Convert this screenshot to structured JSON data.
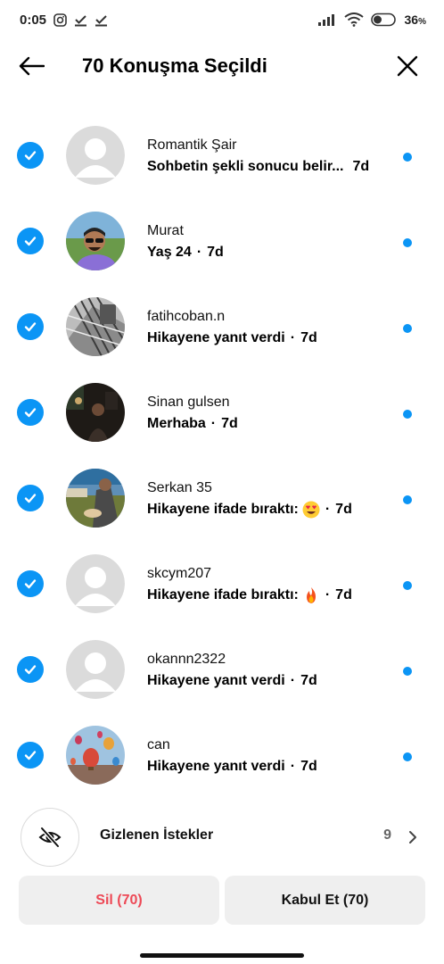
{
  "status_bar": {
    "time": "0:05",
    "battery": "36",
    "battery_unit": "%"
  },
  "header": {
    "title": "70 Konuşma Seçildi"
  },
  "conversations": [
    {
      "name": "Romantik Şair",
      "message": "Sohbetin şekli sonucu belir...",
      "separator": "",
      "time": "7d",
      "avatar": "default-avatar",
      "emoji": ""
    },
    {
      "name": "Murat",
      "message": "Yaş 24",
      "separator": "·",
      "time": "7d",
      "avatar": "photo-man-sunglasses",
      "emoji": ""
    },
    {
      "name": "fatihcoban.n",
      "message": "Hikayene yanıt verdi",
      "separator": "·",
      "time": "7d",
      "avatar": "photo-bw-lines",
      "emoji": ""
    },
    {
      "name": "Sinan gulsen",
      "message": "Merhaba",
      "separator": "·",
      "time": "7d",
      "avatar": "photo-dark-room",
      "emoji": ""
    },
    {
      "name": "Serkan 35",
      "message": "Hikayene ifade bıraktı:",
      "separator": "·",
      "time": "7d",
      "avatar": "photo-outdoor",
      "emoji": "heart-eyes"
    },
    {
      "name": "skcym207",
      "message": "Hikayene ifade bıraktı:",
      "separator": "·",
      "time": "7d",
      "avatar": "default-avatar",
      "emoji": "fire"
    },
    {
      "name": "okannn2322",
      "message": "Hikayene yanıt verdi",
      "separator": "·",
      "time": "7d",
      "avatar": "default-avatar",
      "emoji": ""
    },
    {
      "name": "can",
      "message": "Hikayene yanıt verdi",
      "separator": "·",
      "time": "7d",
      "avatar": "photo-balloons",
      "emoji": ""
    }
  ],
  "hidden_requests": {
    "label": "Gizlenen İstekler",
    "count": "9"
  },
  "actions": {
    "delete_label": "Sil (70)",
    "accept_label": "Kabul Et (70)"
  },
  "colors": {
    "accent": "#0b95f5",
    "delete": "#ed4956",
    "button_bg": "#efefef"
  }
}
